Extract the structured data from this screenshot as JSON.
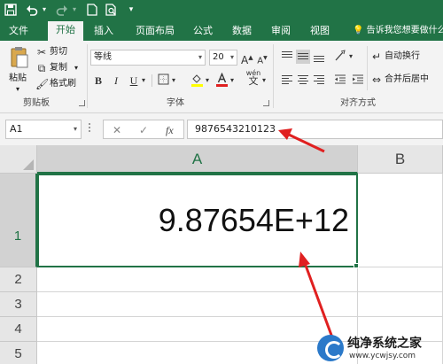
{
  "quick_access": {
    "save_icon": "save-icon",
    "undo_icon": "undo-icon",
    "redo_icon": "redo-icon",
    "new_icon": "new-document-icon",
    "preview_icon": "print-preview-icon",
    "customize_icon": "customize-icon"
  },
  "tabs": [
    {
      "label": "文件"
    },
    {
      "label": "开始",
      "active": true
    },
    {
      "label": "插入"
    },
    {
      "label": "页面布局"
    },
    {
      "label": "公式"
    },
    {
      "label": "数据"
    },
    {
      "label": "审阅"
    },
    {
      "label": "视图"
    }
  ],
  "tell_me": "告诉我您想要做什么",
  "ribbon": {
    "clipboard": {
      "paste": "粘贴",
      "cut": "剪切",
      "copy": "复制",
      "format_painter": "格式刷",
      "group_label": "剪贴板"
    },
    "font": {
      "font_name": "等线",
      "font_size": "20",
      "grow": "A",
      "shrink": "A",
      "bold": "B",
      "italic": "I",
      "underline": "U",
      "underline_dd": "▾",
      "group_label": "字体",
      "wen": "wén",
      "wen_char": "文"
    },
    "alignment": {
      "wrap_text": "自动换行",
      "merge_center": "合并后居中",
      "group_label": "对齐方式"
    }
  },
  "formula_bar": {
    "name_box": "A1",
    "cancel": "✕",
    "enter": "✓",
    "fx": "fx",
    "formula_value": "9876543210123"
  },
  "sheet": {
    "columns": [
      "A",
      "B"
    ],
    "rows": [
      "1",
      "2",
      "3",
      "4",
      "5"
    ],
    "a1_value": "9.87654E+12"
  },
  "watermark": {
    "title": "纯净系统之家",
    "url": "www.ycwjsy.com"
  },
  "colors": {
    "excel_green": "#217346",
    "arrow_red": "#e02020"
  }
}
